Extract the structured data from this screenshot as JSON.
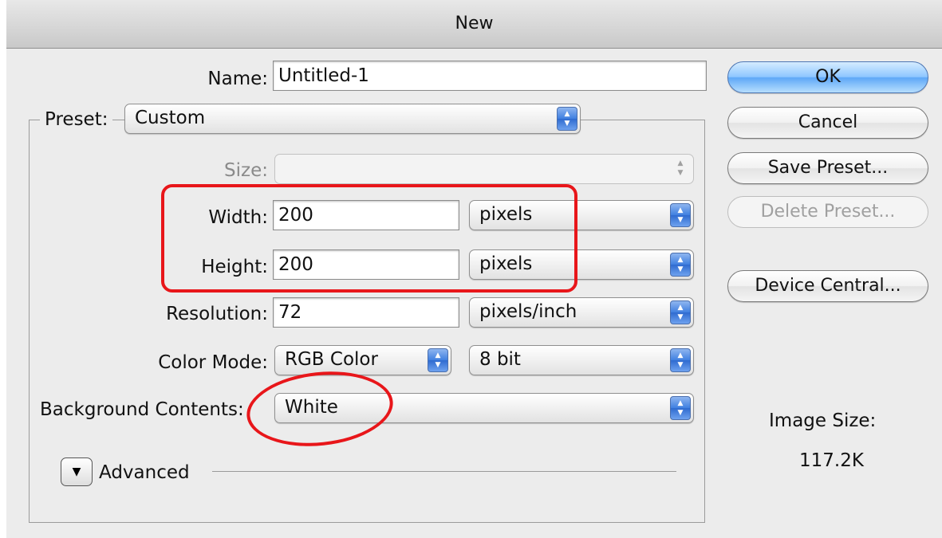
{
  "window": {
    "title": "New"
  },
  "form": {
    "name_label": "Name:",
    "name_value": "Untitled-1",
    "preset_label": "Preset:",
    "preset_value": "Custom",
    "size_label": "Size:",
    "size_value": "",
    "width_label": "Width:",
    "width_value": "200",
    "width_unit": "pixels",
    "height_label": "Height:",
    "height_value": "200",
    "height_unit": "pixels",
    "resolution_label": "Resolution:",
    "resolution_value": "72",
    "resolution_unit": "pixels/inch",
    "color_mode_label": "Color Mode:",
    "color_mode_value": "RGB Color",
    "bit_depth_value": "8 bit",
    "background_label": "Background Contents:",
    "background_value": "White",
    "advanced_label": "Advanced"
  },
  "buttons": {
    "ok": "OK",
    "cancel": "Cancel",
    "save_preset": "Save Preset...",
    "delete_preset": "Delete Preset...",
    "device_central": "Device Central..."
  },
  "info": {
    "image_size_label": "Image Size:",
    "image_size_value": "117.2K"
  },
  "icons": {
    "popup_arrows": "up-down-arrows-icon",
    "advanced_toggle": "disclosure-triangle-icon"
  },
  "colors": {
    "annotation": "#e8161a",
    "popup_accent": "#3f7fe0",
    "default_button": "#8fc7ff"
  }
}
